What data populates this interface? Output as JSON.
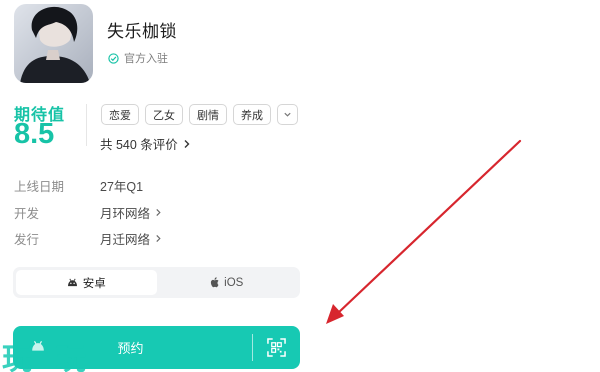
{
  "game": {
    "name": "失乐枷锁",
    "official_label": "官方入驻"
  },
  "rating": {
    "label": "期待值",
    "score": "8.5"
  },
  "tags": [
    "恋爱",
    "乙女",
    "剧情",
    "养成"
  ],
  "reviews": {
    "text": "共 540 条评价"
  },
  "info": {
    "release_label": "上线日期",
    "release_value": "27年Q1",
    "developer_label": "开发",
    "developer_value": "月环网络",
    "publisher_label": "发行",
    "publisher_value": "月迁网络"
  },
  "platforms": {
    "android": "安卓",
    "ios": "iOS",
    "selected": "安卓"
  },
  "actions": {
    "reserve": "预约"
  },
  "watermark": "玩玩",
  "colors": {
    "accent": "#17c9b3",
    "rating": "#17c3a7",
    "annotation_arrow": "#d7262e"
  },
  "icons": {
    "official": "verified-check-icon",
    "reviews_chevron": "chevron-right-icon",
    "tags_more": "chevron-down-icon",
    "android": "android-icon",
    "ios": "apple-icon",
    "qr": "qr-scan-icon"
  }
}
